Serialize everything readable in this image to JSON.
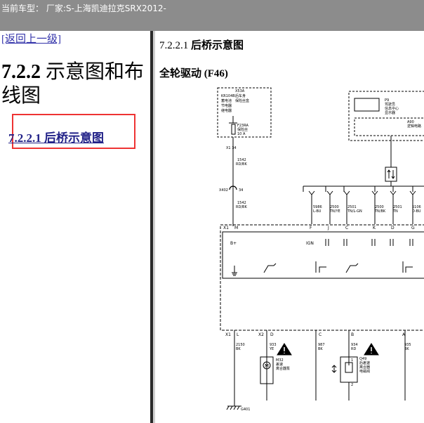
{
  "topbar": {
    "text": "当前车型： 厂家:S-上海凯迪拉克SRX2012-"
  },
  "left": {
    "back_link": "[返回上一级]",
    "heading_num": "7.2.2",
    "heading_text": "示意图和布线图",
    "sub_link": "7.2.2.1 后桥示意图"
  },
  "right": {
    "section_num": "7.2.2.1",
    "section_title": "后桥示意图",
    "subtitle": "全轮驱动 (F46)"
  },
  "diagram": {
    "fuse_box": [
      "X53A",
      "后车身",
      "保险丝盒"
    ],
    "kr": [
      "KR104B",
      "蓄电池",
      "节电器",
      "继电器"
    ],
    "fuse": [
      "F23RA",
      "保险丝",
      "10 A"
    ],
    "x1_34": "X1  34",
    "wire_1542_a": [
      "1542",
      "RD/BK"
    ],
    "x402": "X402",
    "x402_pin": "34",
    "wire_1542_b": [
      "1542",
      "RD/BK"
    ],
    "p9": [
      "P9",
      "驾驶员",
      "信息中心",
      "显示器"
    ],
    "a90": [
      "A90",
      "逻辑电路"
    ],
    "bus_wires": [
      [
        "5986",
        "L-BU"
      ],
      [
        "2500",
        "TN/YE"
      ],
      [
        "2501",
        "TN/L-GN"
      ],
      [
        "2500",
        "TN/BK"
      ],
      [
        "2501",
        "TN"
      ],
      [
        "5106",
        "D-BU"
      ]
    ],
    "pins_top": [
      "X1",
      "M",
      "F",
      "J",
      "C",
      "K",
      "D",
      "G"
    ],
    "bplus": "B+",
    "ign": "IGN",
    "pins_bottom": [
      "X1",
      "L",
      "X2",
      "D",
      "C",
      "B",
      "A"
    ],
    "wires_bottom": [
      [
        "2150",
        "BK"
      ],
      [
        "933",
        "YE"
      ],
      [
        "987",
        "BK"
      ],
      [
        "934",
        "RD"
      ],
      [
        "935",
        "BK"
      ]
    ],
    "m32": [
      "M32",
      "差速",
      "离合器泵"
    ],
    "q49": [
      "Q49",
      "后差速",
      "离合器",
      "电磁阀"
    ],
    "g401": "G401",
    "q_pins": [
      "1",
      "2"
    ]
  }
}
